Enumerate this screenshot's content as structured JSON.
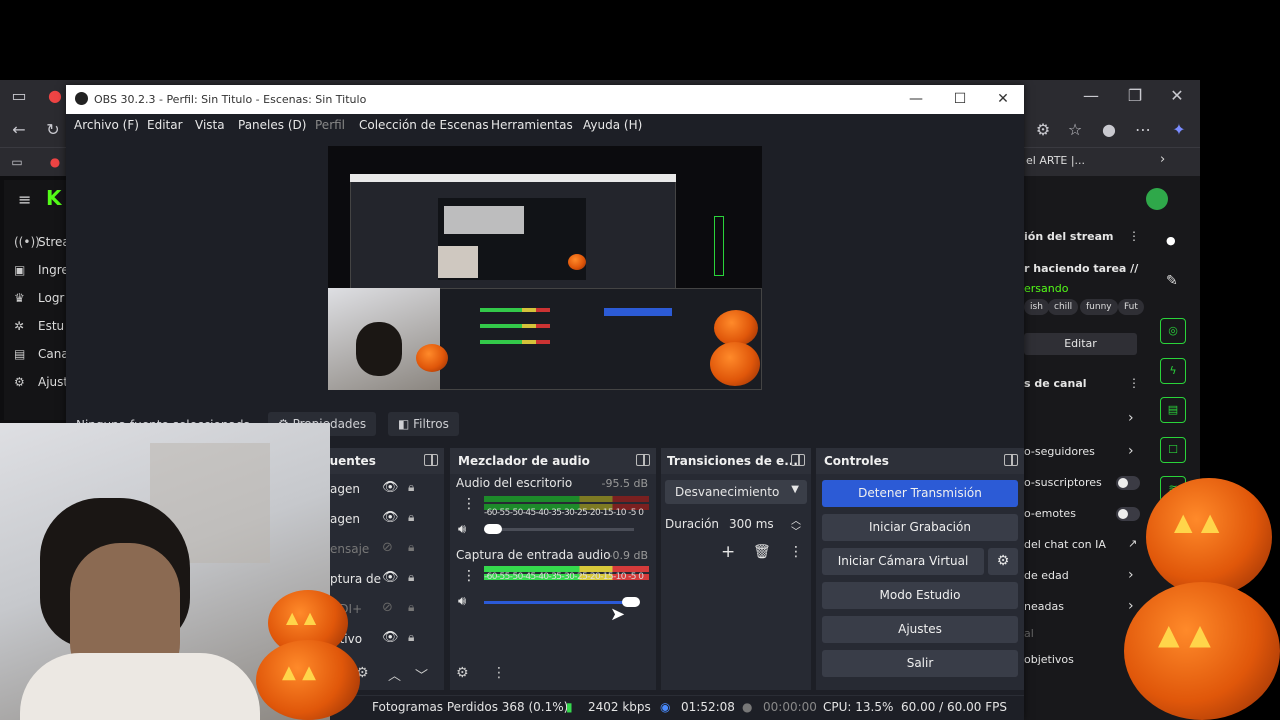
{
  "obs": {
    "title": "OBS 30.2.3 - Perfil: Sin Titulo - Escenas: Sin Titulo",
    "menu": [
      "Archivo (F)",
      "Editar",
      "Vista",
      "Paneles (D)",
      "Perfil",
      "Colección de Escenas",
      "Herramientas",
      "Ayuda (H)"
    ],
    "source_toolbar": {
      "no_source": "Ninguna fuente seleccionada",
      "properties": "Propiedades",
      "filters": "Filtros"
    },
    "sources_dock": {
      "title": "Fuentes",
      "items": [
        "agen",
        "agen",
        "ensaje",
        "ptura de",
        "GDI+",
        "sitivo"
      ]
    },
    "mixer": {
      "title": "Mezclador de audio",
      "tracks": [
        {
          "name": "Audio del escritorio",
          "db": "-95.5 dB",
          "scale": "-60-55-50-45-40-35-30-25-20-15-10 -5  0"
        },
        {
          "name": "Captura de entrada audio",
          "db": "-0.9 dB",
          "scale": "-60-55-50-45-40-35-30-25-20-15-10 -5  0",
          "level": 0.97
        }
      ]
    },
    "transitions": {
      "title": "Transiciones de e...",
      "selected": "Desvanecimiento",
      "duration_label": "Duración",
      "duration_value": "300 ms"
    },
    "controls": {
      "title": "Controles",
      "buttons": [
        "Detener Transmisión",
        "Iniciar Grabación",
        "Iniciar Cámara Virtual",
        "Modo Estudio",
        "Ajustes",
        "Salir"
      ]
    },
    "status": {
      "dropped": "Fotogramas Perdidos 368 (0.1%)",
      "bitrate": "2402 kbps",
      "stream_time": "01:52:08",
      "rec_time": "00:00:00",
      "cpu": "CPU: 13.5%",
      "fps": "60.00 / 60.00 FPS"
    }
  },
  "browser": {
    "bookmark_tail": "el ARTE |...",
    "left_nav": [
      "Strea",
      "Ingre",
      "Logr",
      "Estu",
      "Cana",
      "Ajust"
    ],
    "right_panel": {
      "stream_info": "ión del stream",
      "stream_title": "r haciendo tarea //",
      "category": "ersando",
      "tags": [
        "ish",
        "chill",
        "funny",
        "Fut"
      ],
      "edit": "Editar",
      "channel": "s de canal",
      "rows": [
        "o-seguidores",
        "o-suscriptores",
        "o-emotes",
        "del chat con IA",
        "de edad",
        "neadas",
        "al",
        "objetivos"
      ]
    }
  },
  "colors": {
    "accent": "#2c5bd6",
    "meter_green": "#35d94d",
    "kick_green": "#53fc18"
  }
}
